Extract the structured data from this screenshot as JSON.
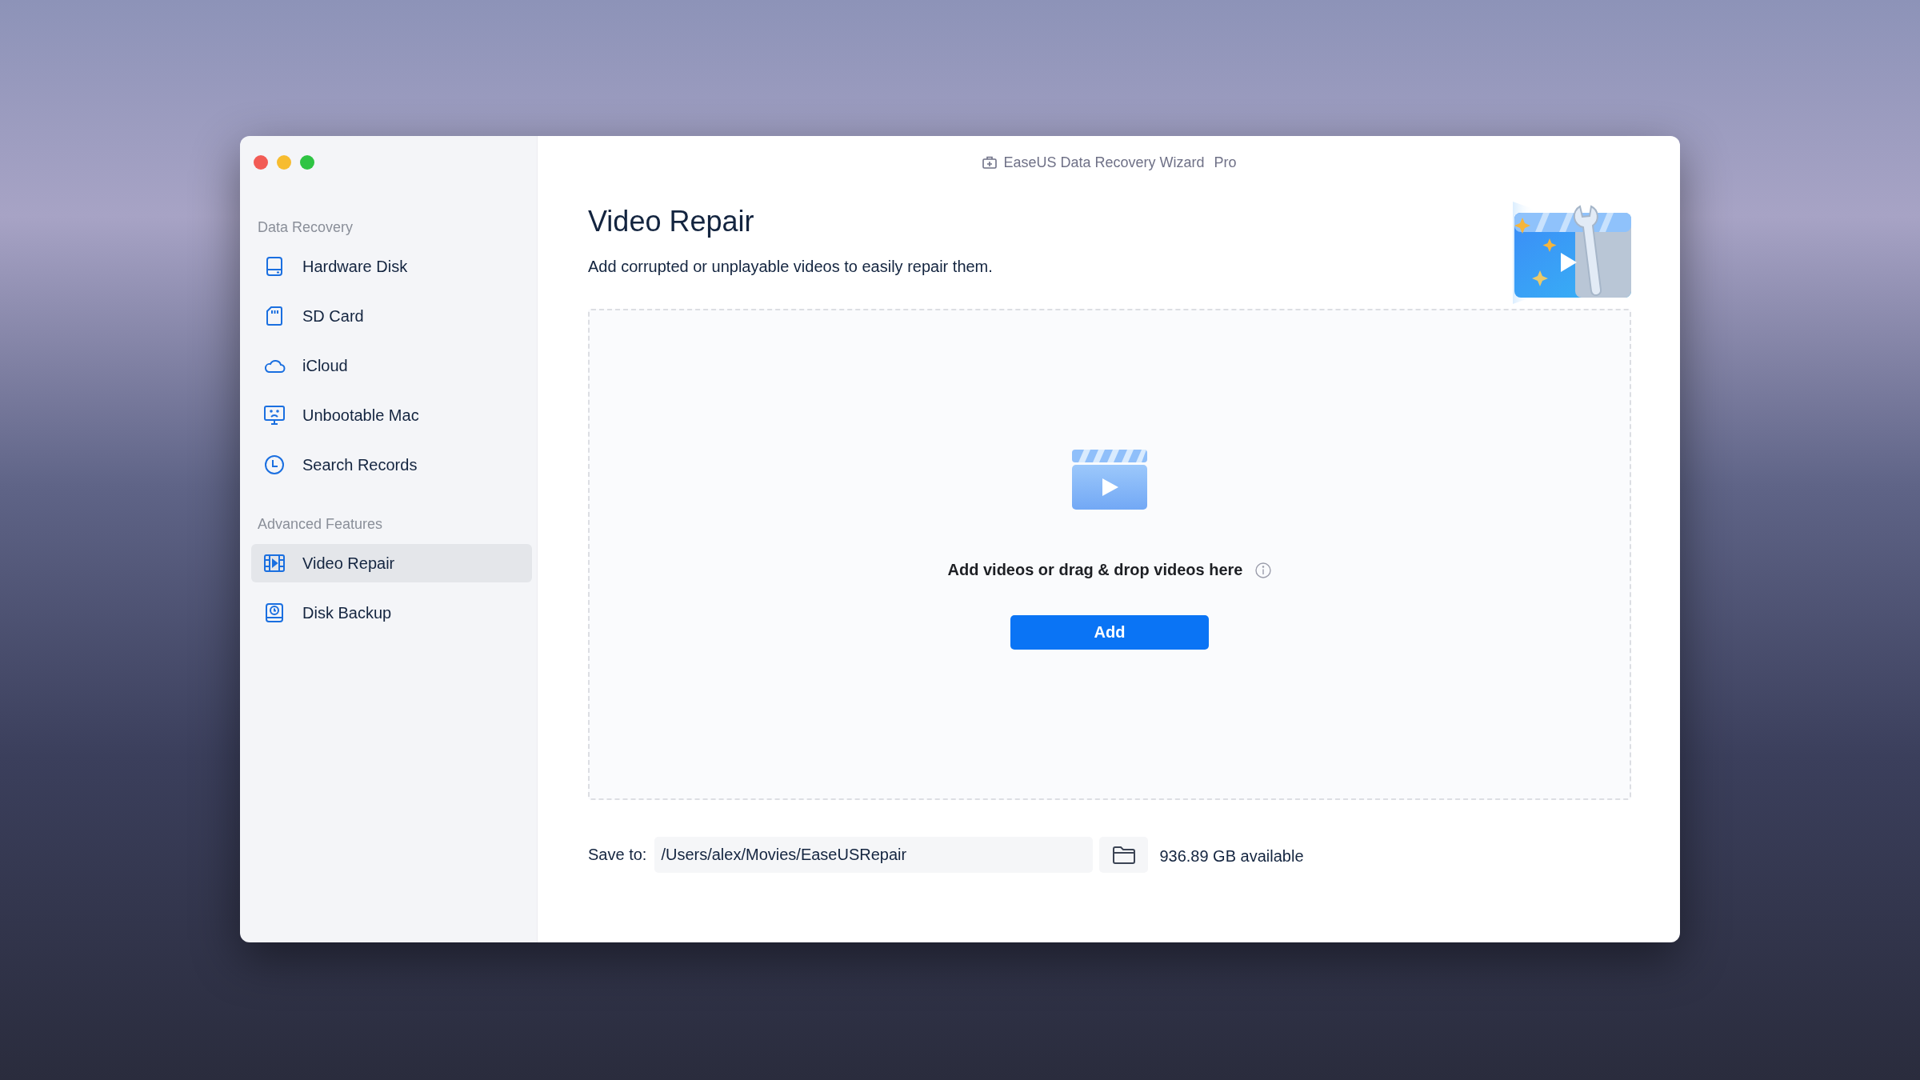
{
  "window": {
    "title": "EaseUS Data Recovery Wizard",
    "edition": "Pro"
  },
  "sidebar": {
    "sections": [
      {
        "heading": "Data Recovery",
        "items": [
          {
            "label": "Hardware Disk",
            "selected": false
          },
          {
            "label": "SD Card",
            "selected": false
          },
          {
            "label": "iCloud",
            "selected": false
          },
          {
            "label": "Unbootable Mac",
            "selected": false
          },
          {
            "label": "Search Records",
            "selected": false
          }
        ]
      },
      {
        "heading": "Advanced Features",
        "items": [
          {
            "label": "Video Repair",
            "selected": true
          },
          {
            "label": "Disk Backup",
            "selected": false
          }
        ]
      }
    ]
  },
  "page": {
    "title": "Video Repair",
    "subtitle": "Add corrupted or unplayable videos to easily repair them."
  },
  "drop_zone": {
    "prompt": "Add videos or drag & drop videos here",
    "button": "Add"
  },
  "save": {
    "label": "Save to:",
    "path": "/Users/alex/Movies/EaseUSRepair",
    "available": "936.89 GB available"
  }
}
